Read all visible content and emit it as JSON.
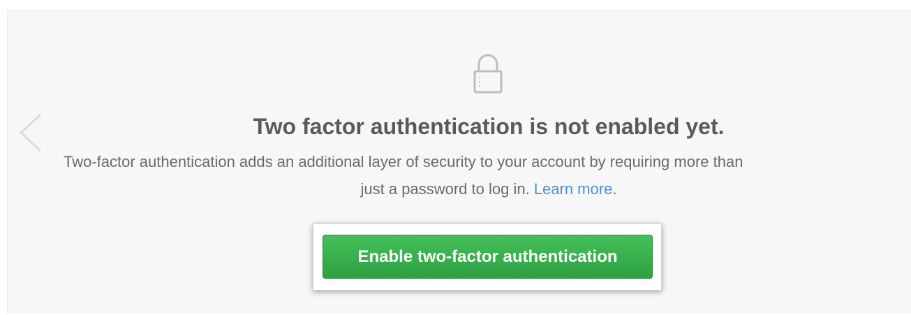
{
  "lock_icon": "lock-icon",
  "prev_arrow_icon": "chevron-left-icon",
  "title": "Two factor authentication is not enabled yet.",
  "description": {
    "line1": "Two-factor authentication adds an additional layer of security to your account by requiring more than",
    "line2_text": "just a password to log in. ",
    "learn_more": "Learn more",
    "period": "."
  },
  "button": {
    "label": "Enable two-factor authentication"
  },
  "colors": {
    "panel_bg": "#f7f7f7",
    "title": "#5a5a5a",
    "body_text": "#6a6a6a",
    "link": "#4a90e2",
    "button_green": "#2ea043",
    "button_text": "#ffffff"
  }
}
